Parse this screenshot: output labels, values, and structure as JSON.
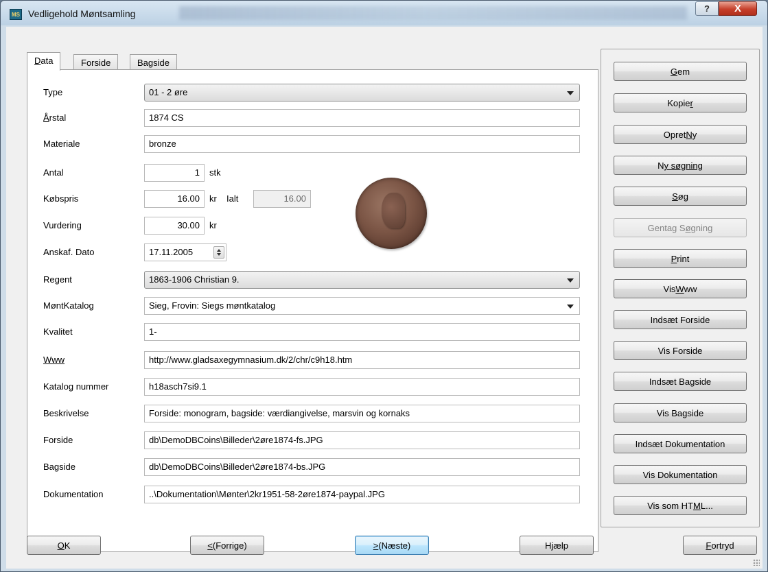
{
  "window": {
    "title": "Vedligehold Møntsamling",
    "icon_text": "MS",
    "help_symbol": "?",
    "close_symbol": "X"
  },
  "tabs": [
    {
      "label_u": "D",
      "label_rest": "ata",
      "active": true
    },
    {
      "label": "Forside"
    },
    {
      "label": "Bagside"
    }
  ],
  "fields": {
    "type": {
      "label": "Type",
      "value": "01 - 2 øre"
    },
    "aarstal": {
      "label_u": "Å",
      "label_rest": "rstal",
      "value": "1874 CS"
    },
    "materiale": {
      "label": "Materiale",
      "value": "bronze"
    },
    "antal": {
      "label": "Antal",
      "value": "1",
      "unit": "stk"
    },
    "koebspris": {
      "label": "Købspris",
      "value": "16.00",
      "unit": "kr",
      "ialt_label": "Ialt",
      "ialt_value": "16.00"
    },
    "vurdering": {
      "label": "Vurdering",
      "value": "30.00",
      "unit": "kr"
    },
    "anskaf_dato": {
      "label": "Anskaf. Dato",
      "value": "17.11.2005"
    },
    "regent": {
      "label": "Regent",
      "value": "1863-1906 Christian 9."
    },
    "moentkatalog": {
      "label": "MøntKatalog",
      "value": "Sieg, Frovin: Siegs møntkatalog"
    },
    "kvalitet": {
      "label": "Kvalitet",
      "value": "1-"
    },
    "www": {
      "label": "Www",
      "value": "http://www.gladsaxegymnasium.dk/2/chr/c9h18.htm"
    },
    "katalog_nummer": {
      "label": "Katalog nummer",
      "value": "h18asch7si9.1"
    },
    "beskrivelse": {
      "label": "Beskrivelse",
      "value": "Forside: monogram, bagside: værdiangivelse, marsvin og kornaks"
    },
    "forside": {
      "label": "Forside",
      "value": "db\\DemoDBCoins\\Billeder\\2øre1874-fs.JPG"
    },
    "bagside": {
      "label": "Bagside",
      "value": "db\\DemoDBCoins\\Billeder\\2øre1874-bs.JPG"
    },
    "dokumentation": {
      "label": "Dokumentation",
      "value": "..\\Dokumentation\\Mønter\\2kr1951-58-2øre1874-paypal.JPG"
    }
  },
  "side_buttons": {
    "gem": {
      "u": "G",
      "rest": "em"
    },
    "kopier": {
      "pre": "Kopie",
      "u": "r"
    },
    "opret_ny": {
      "pre": "Opret ",
      "u": "N",
      "rest": "y"
    },
    "ny_soegning": {
      "pre": "N",
      "u": "y søgning"
    },
    "soeg": {
      "u": "S",
      "rest": "øg"
    },
    "gentag_soegning": {
      "pre": "Gentag S",
      "u": "ø",
      "rest": "gning"
    },
    "print": {
      "u": "P",
      "rest": "rint"
    },
    "vis_www": {
      "pre": "Vis ",
      "u": "W",
      "rest": "ww"
    },
    "indsaet_forside": {
      "label": "Indsæt Forside"
    },
    "vis_forside": {
      "label": "Vis Forside"
    },
    "indsaet_bagside": {
      "label": "Indsæt Bagside"
    },
    "vis_bagside": {
      "label": "Vis Bagside"
    },
    "indsaet_dokumentation": {
      "label": "Indsæt Dokumentation"
    },
    "vis_dokumentation": {
      "label": "Vis Dokumentation"
    },
    "vis_som_html": {
      "pre": "Vis som HT",
      "u": "M",
      "rest": "L..."
    }
  },
  "bottom_buttons": {
    "ok": {
      "u": "O",
      "rest": "K"
    },
    "forrige": {
      "u": "<",
      "rest": " (Forrige)"
    },
    "naeste": {
      "u": ">",
      "rest": " (Næste)"
    },
    "hjaelp": {
      "pre": "H",
      "u": "j",
      "rest": "ælp"
    },
    "fortryd": {
      "u": "F",
      "rest": "ortryd"
    }
  }
}
